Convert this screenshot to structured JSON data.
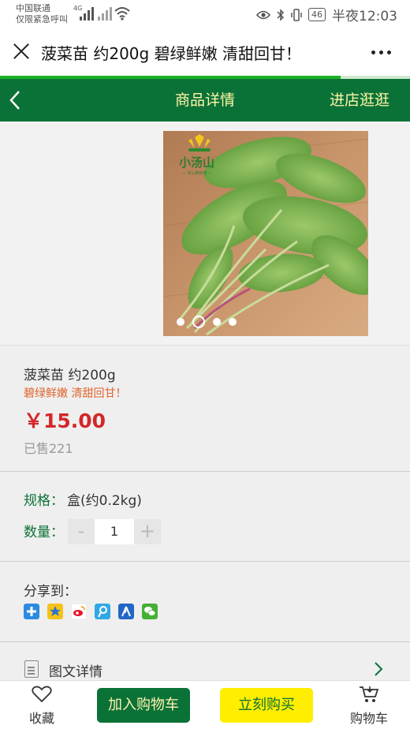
{
  "status_bar": {
    "carrier_line1": "中国联通",
    "carrier_line2": "仅限紧急呼叫",
    "network_tag": "4G",
    "battery": "46",
    "time": "半夜12:03"
  },
  "titlebar": {
    "title": "菠菜苗 约200g 碧绿鲜嫩 清甜回甘！",
    "load_progress": 0.83
  },
  "navbar": {
    "title": "商品详情",
    "store_link": "进店逛逛"
  },
  "gallery": {
    "slide_count": 4,
    "active_index": 1,
    "brand_text": "小汤山",
    "brand_slogan": "— 专心种好菜 —"
  },
  "product": {
    "name": "菠菜苗 约200g",
    "subtitle": "碧绿鲜嫩 清甜回甘！",
    "price": "￥15.00",
    "sold": "已售221"
  },
  "specs": {
    "spec_label": "规格：",
    "spec_value": "盒(约0.2kg)",
    "qty_label": "数量：",
    "qty_minus": "-",
    "qty_value": "1",
    "qty_plus": "+"
  },
  "share": {
    "label": "分享到：",
    "icons": [
      "plus-share-icon",
      "qzone-icon",
      "weibo-icon",
      "tencent-weibo-icon",
      "renren-icon",
      "wechat-icon"
    ]
  },
  "details": {
    "label": "图文详情"
  },
  "bottom": {
    "fav_label": "收藏",
    "add_cart_label": "加入购物车",
    "buy_now_label": "立刻购买",
    "cart_label": "购物车"
  },
  "colors": {
    "brand_green": "#0b7237",
    "price_red": "#d3272a",
    "subtitle_orange": "#e0632b",
    "buy_yellow": "#ffee00",
    "nav_text": "#fff5a8"
  }
}
